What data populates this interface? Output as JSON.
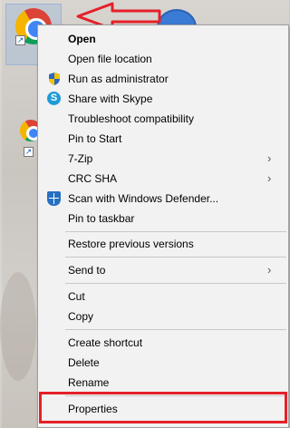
{
  "menu": {
    "items": [
      {
        "label": "Open",
        "bold": true
      },
      {
        "label": "Open file location"
      },
      {
        "label": "Run as administrator",
        "icon": "uac-shield-icon"
      },
      {
        "label": "Share with Skype",
        "icon": "skype-icon"
      },
      {
        "label": "Troubleshoot compatibility"
      },
      {
        "label": "Pin to Start"
      },
      {
        "label": "7-Zip",
        "submenu": true
      },
      {
        "label": "CRC SHA",
        "submenu": true
      },
      {
        "label": "Scan with Windows Defender...",
        "icon": "windows-defender-icon"
      },
      {
        "label": "Pin to taskbar"
      },
      {
        "label": "Restore previous versions"
      },
      {
        "label": "Send to",
        "submenu": true
      },
      {
        "label": "Cut"
      },
      {
        "label": "Copy"
      },
      {
        "label": "Create shortcut"
      },
      {
        "label": "Delete"
      },
      {
        "label": "Rename"
      },
      {
        "label": "Properties"
      }
    ]
  },
  "annotations": {
    "arrow_color": "#e5202a",
    "highlight_color": "#e5202a"
  },
  "colors": {
    "menu_background": "#f2f2f2",
    "separator": "#c8c8c8"
  }
}
